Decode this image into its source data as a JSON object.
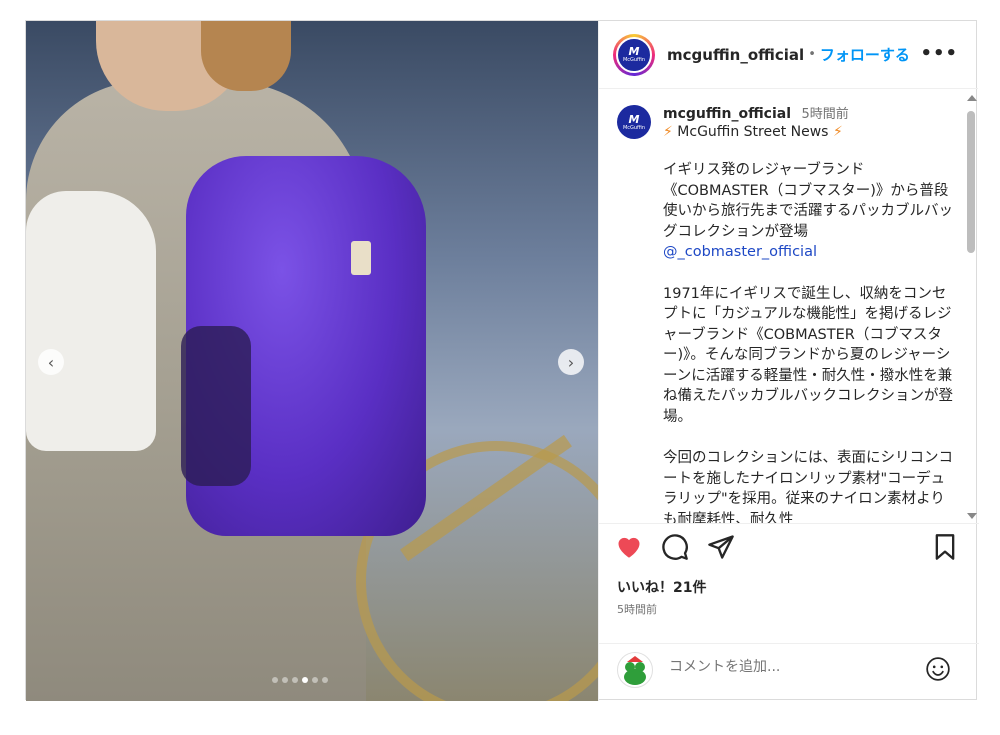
{
  "header": {
    "username": "mcguffin_official",
    "separator": "•",
    "follow_label": "フォローする",
    "more_label": "•••",
    "avatar_mark": "M",
    "avatar_sub": "McGuffin"
  },
  "caption": {
    "username": "mcguffin_official",
    "time": "5時間前",
    "bolt": "⚡",
    "title": "McGuffin Street News",
    "para1": "イギリス発のレジャーブランド《COBMASTER（コブマスター)》から普段使いから旅行先まで活躍するパッカブルバッグコレクションが登場",
    "mention": "@_cobmaster_official",
    "para2": "1971年にイギリスで誕生し、収納をコンセプトに「カジュアルな機能性」を掲げるレジャーブランド《COBMASTER（コブマスター)》。そんな同ブランドから夏のレジャーシーンに活躍する軽量性・耐久性・撥水性を兼ね備えたパッカブルバックコレクションが登場。",
    "para3": "今回のコレクションには、表面にシリコンコートを施したナイロンリップ素材\"コーデュラリップ\"を採用。従来のナイロン素材よりも耐摩耗性、耐久性"
  },
  "actions": {
    "likes": "いいね！21件",
    "time": "5時間前",
    "liked": true,
    "heart_color": "#ed4956"
  },
  "comment": {
    "placeholder": "コメントを追加..."
  },
  "carousel": {
    "prev": "‹",
    "next": "›",
    "total": 6,
    "current": 3
  },
  "colors": {
    "follow": "#0095f6",
    "mention": "#1e48c5",
    "bolt": "#f08a24"
  }
}
